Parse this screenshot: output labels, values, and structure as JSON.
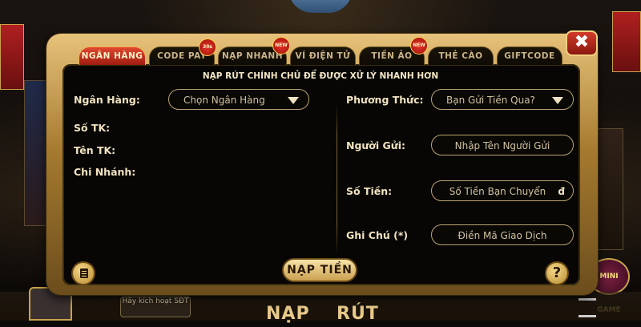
{
  "tabs": [
    {
      "label": "NGÂN HÀNG",
      "active": true
    },
    {
      "label": "CODE PAY",
      "active": false
    },
    {
      "label": "NẠP NHANH",
      "active": false
    },
    {
      "label": "VÍ ĐIỆN TỬ",
      "active": false
    },
    {
      "label": "TIỀN ẢO",
      "active": false
    },
    {
      "label": "THẺ CÀO",
      "active": false
    },
    {
      "label": "GIFTCODE",
      "active": false
    }
  ],
  "badges": {
    "code_pay": "30s",
    "nap_nhanh": "NEW",
    "tien_ao": "NEW"
  },
  "close_symbol": "✖",
  "notice": "NẠP RÚT CHÍNH CHỦ ĐỂ ĐƯỢC XỬ LÝ NHANH HƠN",
  "left_form": {
    "bank_label": "Ngân Hàng:",
    "bank_select": "Chọn Ngân Hàng",
    "account_no_label": "Số TK:",
    "account_name_label": "Tên TK:",
    "branch_label": "Chi Nhánh:"
  },
  "right_form": {
    "method_label": "Phương Thức:",
    "method_select": "Bạn Gửi Tiền Qua?",
    "sender_label": "Người Gửi:",
    "sender_placeholder": "Nhập Tên Người Gửi",
    "amount_label": "Số Tiền:",
    "amount_placeholder": "Số Tiền Bạn Chuyển",
    "amount_currency": "đ",
    "note_label": "Ghi Chú (*)",
    "note_placeholder": "Điền Mã Giao Dịch"
  },
  "submit_label": "NẠP TIỀN",
  "help_symbol": "?",
  "background": {
    "bottom_hint": "Hãy kích hoạt SĐT",
    "bottom_nap": "NẠP",
    "bottom_rut": "RÚT",
    "mini_game": "MINI GAME"
  },
  "colors": {
    "active_tab": "#c8341f",
    "panel_gold": "#c9a24a",
    "panel_inner": "#070604",
    "submit_gold": "#e8c874",
    "close_red": "#c0281c"
  },
  "icons": {
    "close": "close-icon",
    "history": "document-icon",
    "help": "question-icon",
    "dropdown": "chevron-down-icon"
  }
}
